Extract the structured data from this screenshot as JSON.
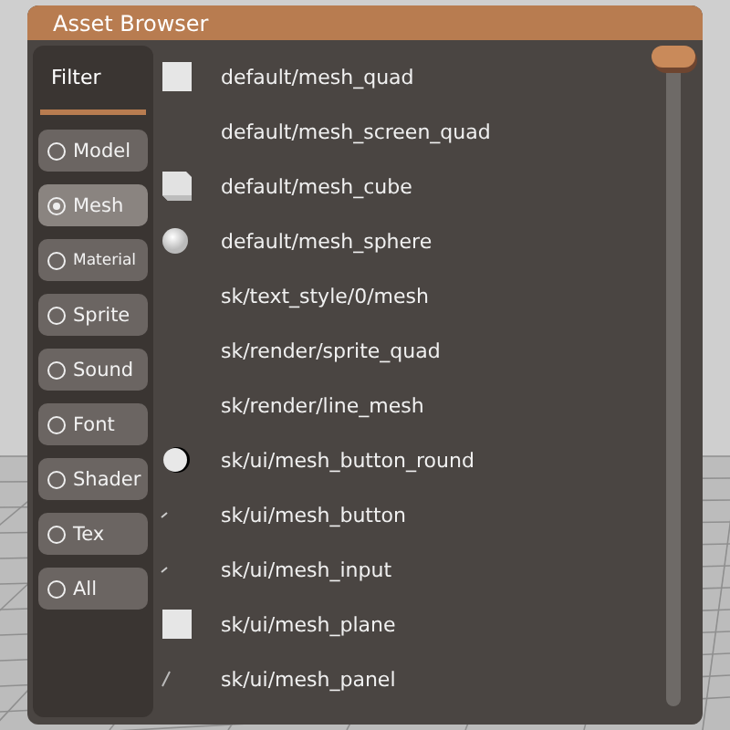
{
  "window": {
    "title": "Asset Browser"
  },
  "filter": {
    "title": "Filter",
    "options": [
      {
        "label": "Model",
        "selected": false
      },
      {
        "label": "Mesh",
        "selected": true
      },
      {
        "label": "Material",
        "selected": false,
        "kind": "small"
      },
      {
        "label": "Sprite",
        "selected": false
      },
      {
        "label": "Sound",
        "selected": false
      },
      {
        "label": "Font",
        "selected": false
      },
      {
        "label": "Shader",
        "selected": false
      },
      {
        "label": "Tex",
        "selected": false
      },
      {
        "label": "All",
        "selected": false
      }
    ]
  },
  "assets": [
    {
      "name": "default/mesh_quad",
      "kind": "square"
    },
    {
      "name": "default/mesh_screen_quad",
      "kind": "none"
    },
    {
      "name": "default/mesh_cube",
      "kind": "cube"
    },
    {
      "name": "default/mesh_sphere",
      "kind": "sphere"
    },
    {
      "name": "sk/text_style/0/mesh",
      "kind": "none"
    },
    {
      "name": "sk/render/sprite_quad",
      "kind": "none"
    },
    {
      "name": "sk/render/line_mesh",
      "kind": "none"
    },
    {
      "name": "sk/ui/mesh_button_round",
      "kind": "round"
    },
    {
      "name": "sk/ui/mesh_button",
      "kind": "speck"
    },
    {
      "name": "sk/ui/mesh_input",
      "kind": "speck"
    },
    {
      "name": "sk/ui/mesh_plane",
      "kind": "square"
    },
    {
      "name": "sk/ui/mesh_panel",
      "kind": "slash"
    }
  ]
}
